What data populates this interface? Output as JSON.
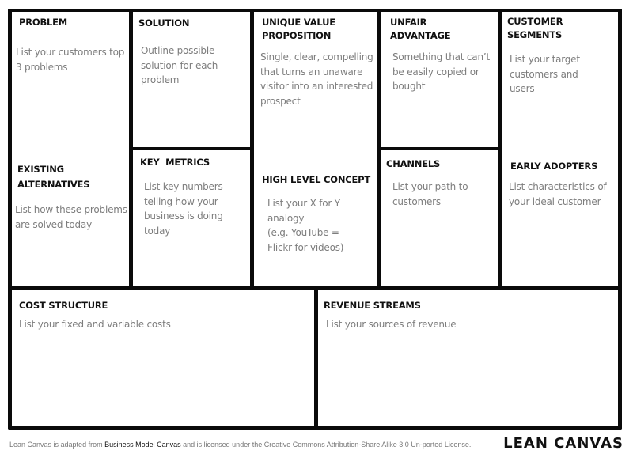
{
  "canvas_title": "LEAN CANVAS",
  "blocks": {
    "problem": {
      "title": "PROBLEM",
      "desc": "List your customers top 3 problems"
    },
    "existing_alternatives": {
      "title": "EXISTING ALTERNATIVES",
      "desc": "List how these problems are solved today"
    },
    "solution": {
      "title": "SOLUTION",
      "desc": "Outline possible solution for each problem"
    },
    "key_metrics": {
      "title": "KEY  METRICS",
      "desc": "List key numbers telling how your business is doing today"
    },
    "unique_value_proposition": {
      "title": "UNIQUE VALUE PROPOSITION",
      "desc": "Single, clear, compelling that turns an unaware visitor into an interested prospect"
    },
    "high_level_concept": {
      "title": "HIGH LEVEL CONCEPT",
      "desc_line1": "List your X for Y analogy",
      "desc_line2": "(e.g. YouTube = Flickr for videos)"
    },
    "unfair_advantage": {
      "title": "UNFAIR ADVANTAGE",
      "desc": "Something that can’t be easily copied or bought"
    },
    "channels": {
      "title": "CHANNELS",
      "desc": "List your path to customers"
    },
    "customer_segments": {
      "title": "CUSTOMER SEGMENTS",
      "desc": "List your target customers and users"
    },
    "early_adopters": {
      "title": "EARLY ADOPTERS",
      "desc": "List characteristics of your ideal customer"
    },
    "cost_structure": {
      "title": "COST STRUCTURE",
      "desc": "List your fixed and variable costs"
    },
    "revenue_streams": {
      "title": "REVENUE STREAMS",
      "desc": "List your sources of revenue"
    }
  },
  "footer": {
    "text_before": "Lean Canvas is adapted from ",
    "link_text": "Business Model Canvas",
    "text_after": " and is licensed under the Creative Commons Attribution-Share Alike 3.0 Un-ported License."
  }
}
